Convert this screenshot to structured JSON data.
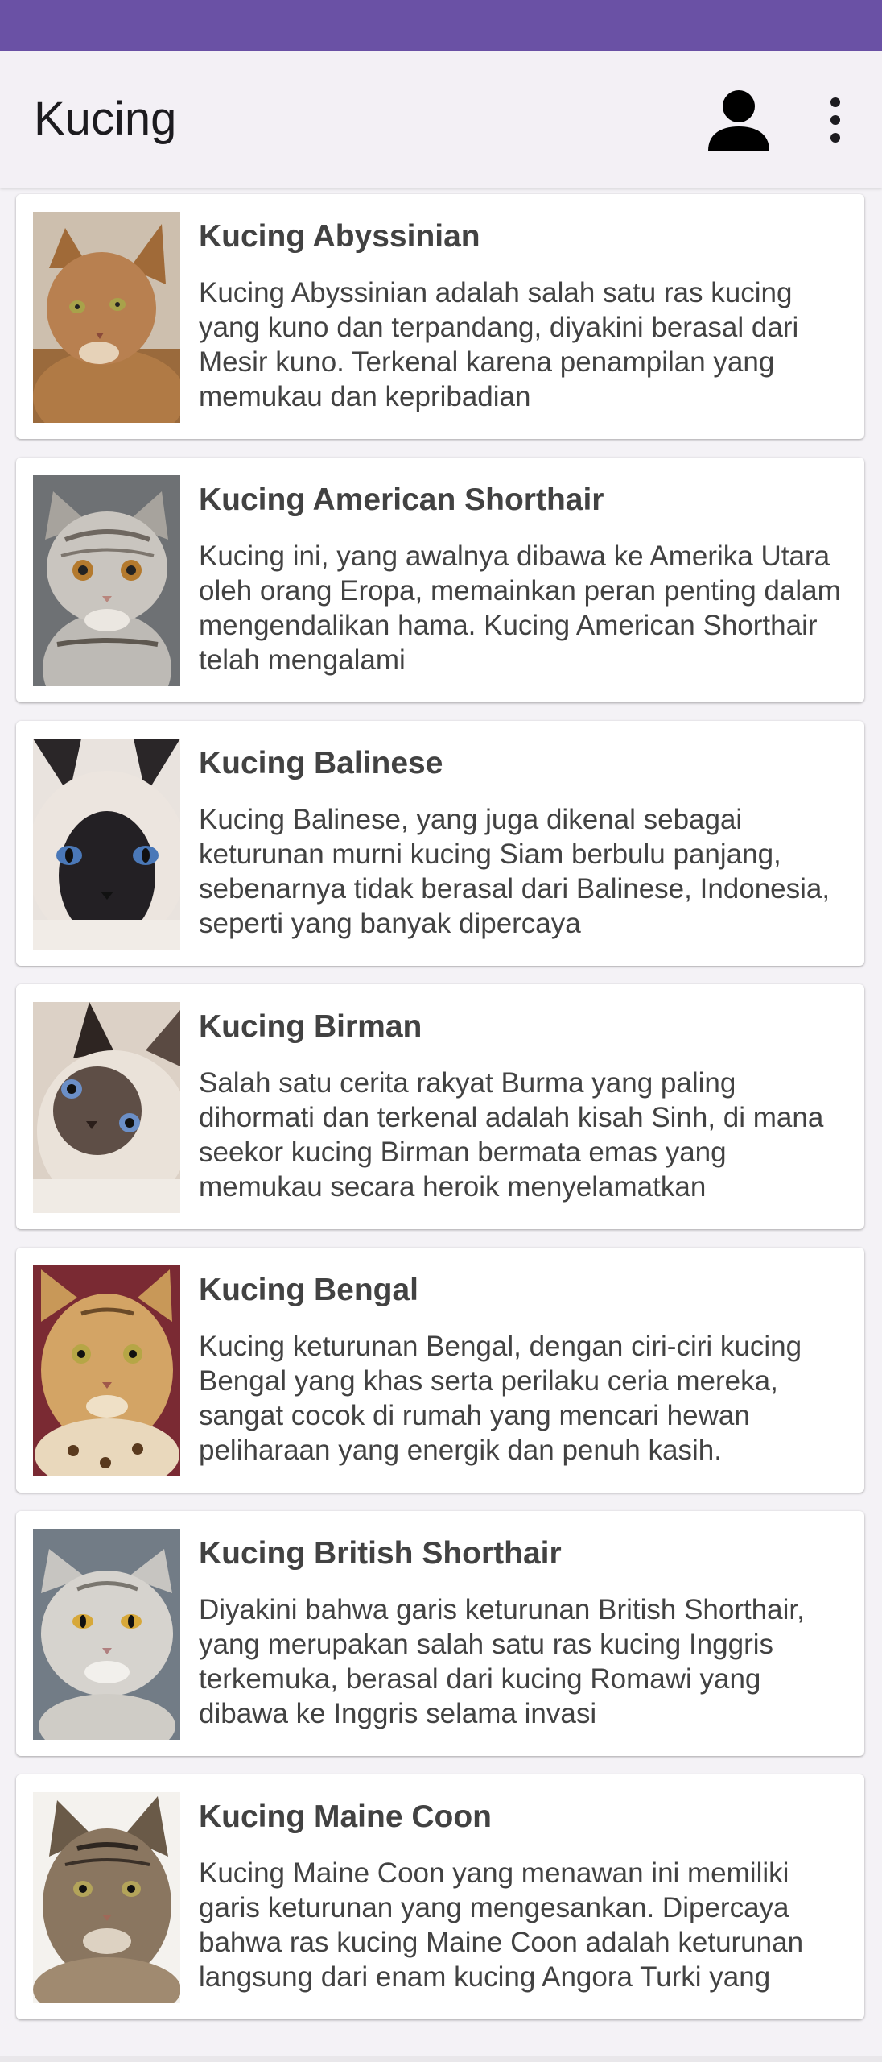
{
  "app": {
    "title": "Kucing",
    "colors": {
      "status_bar": "#6a51a5",
      "app_bar": "#f3f0f5",
      "text": "#424242"
    },
    "icons": {
      "profile": "person-icon",
      "menu": "more-vert-icon"
    }
  },
  "cats": [
    {
      "name": "Kucing Abyssinian",
      "description": "Kucing Abyssinian adalah salah satu ras kucing yang kuno dan terpandang, diyakini berasal dari Mesir kuno. Terkenal karena penampilan yang memukau dan kepribadian",
      "image": "abyssinian-cat-photo"
    },
    {
      "name": "Kucing American Shorthair",
      "description": "Kucing ini, yang awalnya dibawa ke Amerika Utara oleh orang Eropa, memainkan peran penting dalam mengendalikan hama. Kucing American Shorthair telah mengalami",
      "image": "american-shorthair-cat-photo"
    },
    {
      "name": "Kucing Balinese",
      "description": "Kucing Balinese, yang juga dikenal sebagai keturunan murni kucing Siam berbulu panjang, sebenarnya tidak berasal dari Balinese, Indonesia, seperti yang banyak dipercaya",
      "image": "balinese-cat-photo"
    },
    {
      "name": "Kucing Birman",
      "description": "Salah satu cerita rakyat Burma yang paling dihormati dan terkenal adalah kisah Sinh, di mana seekor kucing Birman bermata emas yang memukau secara heroik menyelamatkan",
      "image": "birman-cat-photo"
    },
    {
      "name": "Kucing Bengal",
      "description": "Kucing keturunan Bengal, dengan ciri-ciri kucing Bengal yang khas serta perilaku ceria mereka, sangat cocok di rumah yang mencari hewan peliharaan yang energik dan penuh kasih.",
      "image": "bengal-cat-photo"
    },
    {
      "name": "Kucing British Shorthair",
      "description": "Diyakini bahwa garis keturunan British Shorthair, yang merupakan salah satu ras kucing Inggris terkemuka, berasal dari kucing Romawi yang dibawa ke Inggris selama invasi",
      "image": "british-shorthair-cat-photo"
    },
    {
      "name": "Kucing Maine Coon",
      "description": "Kucing Maine Coon yang menawan ini memiliki garis keturunan yang mengesankan. Dipercaya bahwa ras kucing Maine Coon adalah keturunan langsung dari enam kucing Angora Turki yang",
      "image": "maine-coon-cat-photo"
    }
  ]
}
